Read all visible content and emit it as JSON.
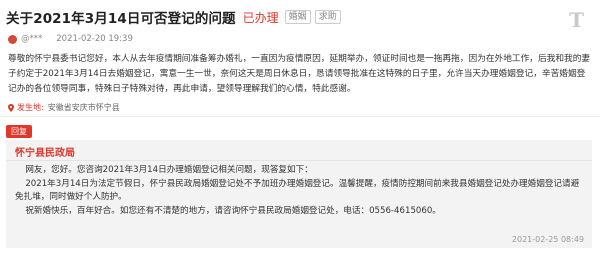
{
  "header": {
    "title": "关于2021年3月14日可否登记的问题",
    "status": "已办理",
    "tags": [
      "婚姻",
      "求助"
    ],
    "corner_icon": "T"
  },
  "meta": {
    "author": "@***",
    "date": "2021-02-20 19:39"
  },
  "question": {
    "body": "尊敬的怀宁县委书记您好，本人从去年疫情期间准备筹办婚礼，一直因为疫情原因，延期举办，领证时间也是一拖再拖，因为在外地工作，后我和我的妻子约定于2021年3月14日去婚姻登记，寓意一生一世，奈何这天是周日休息日，恳请领导批准在这特殊的日子里，允许当天办理婚姻登记，辛苦婚姻登记办的各位领导同事，特殊日子特殊对待，再此申请，望领导理解我们的心情，特此感谢。"
  },
  "location": {
    "label": "发生地:",
    "value": "安徽省安庆市怀宁县"
  },
  "reply": {
    "badge": "回复",
    "org": "怀宁县民政局",
    "lines": [
      "网友，您好。您咨询2021年3月14日办理婚姻登记相关问题，现答复如下：",
      "2021年3月14日为法定节假日，怀宁县民政局婚姻登记处不予加班办理婚姻登记。温馨提醒，疫情防控期间前来我县婚姻登记处办理婚姻登记请避免扎堆，同时做好个人防护。",
      "祝新婚快乐，百年好合。如您还有不清楚的地方，请咨询怀宁县民政局婚姻登记处，电话：0556-4615060。"
    ],
    "date": "2021-02-25 08:49"
  },
  "colors": {
    "accent": "#e0372b",
    "reply_bg": "#f3f3f3"
  }
}
